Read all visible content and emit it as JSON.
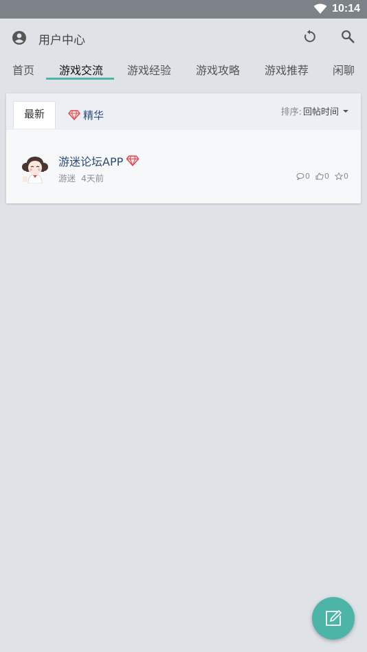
{
  "status_bar": {
    "time": "10:14",
    "wifi_icon": "wifi-icon"
  },
  "header": {
    "title": "用户中心",
    "user_icon": "account-circle-icon",
    "refresh_icon": "refresh-icon",
    "search_icon": "search-icon"
  },
  "tabs": [
    {
      "label": "首页"
    },
    {
      "label": "游戏交流"
    },
    {
      "label": "游戏经验"
    },
    {
      "label": "游戏攻略"
    },
    {
      "label": "游戏推荐"
    },
    {
      "label": "闲聊"
    }
  ],
  "active_tab": "游戏交流",
  "sub_tabs": {
    "latest": "最新",
    "featured": "精华"
  },
  "sort": {
    "label": "排序:",
    "value": "回帖时间"
  },
  "posts": [
    {
      "title": "游迷论坛APP",
      "author": "游迷",
      "time": "4天前",
      "comments": "0",
      "likes": "0",
      "favorites": "0",
      "featured": true
    }
  ],
  "fab_icon": "edit-icon",
  "colors": {
    "accent": "#4cb5a8",
    "link": "#2b4a78",
    "gem": "#e0474c"
  }
}
